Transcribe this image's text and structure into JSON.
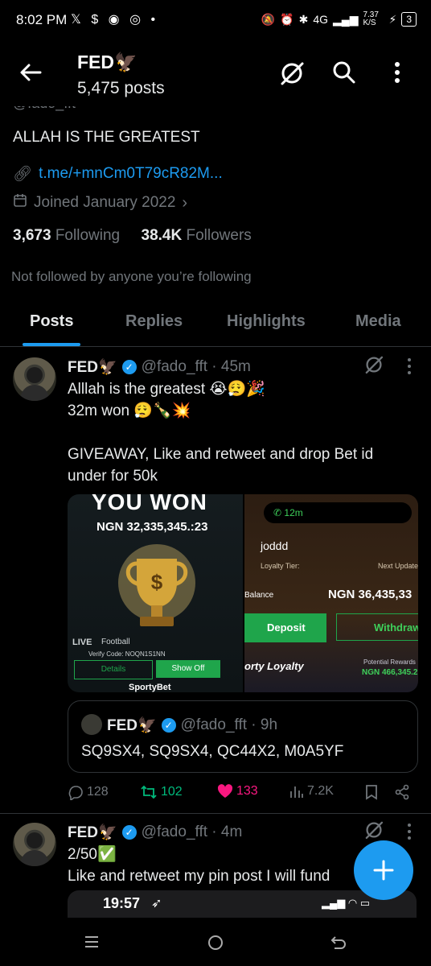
{
  "status_bar": {
    "time": "8:02 PM",
    "notif_icons": "𝕏 $ ◉ ◎ •",
    "network": "4G",
    "speed": "7.37 K/S",
    "battery": "3"
  },
  "header": {
    "title": "FED🦅",
    "posts_count": "5,475 posts"
  },
  "profile": {
    "handle_partial": "@fado_fft",
    "bio": "ALLAH IS THE GREATEST",
    "link": "t.me/+mnCm0T79cR82M...",
    "joined": "Joined January 2022",
    "following_count": "3,673",
    "following_label": "Following",
    "followers_count": "38.4K",
    "followers_label": "Followers",
    "not_followed": "Not followed by anyone you’re following"
  },
  "tabs": [
    {
      "label": "Posts",
      "active": true
    },
    {
      "label": "Replies",
      "active": false
    },
    {
      "label": "Highlights",
      "active": false
    },
    {
      "label": "Media",
      "active": false
    }
  ],
  "post1": {
    "name": "FED🦅",
    "handle_time": "@fado_fft · 45m",
    "text": "Alllah is the greatest 😭😮‍💨🎉\n32m won 😮‍💨🍾💥\n\nGIVEAWAY, Like and retweet and drop Bet id under for 50k",
    "media_left": {
      "headline": "YOU WON",
      "amount": "NGN 32,335,345.:23",
      "verify": "Verify Code: NOQN1S1NN",
      "details": "Details",
      "show_off": "Show Off",
      "brand": "SportyBet",
      "live": "LIVE",
      "football": "Football"
    },
    "media_right": {
      "call_time": "12m",
      "user": "joddd",
      "loyalty": "Loyalty Tier:",
      "next_update": "Next Update",
      "balance_label": "Balance",
      "balance": "NGN 36,435,33",
      "deposit": "Deposit",
      "withdraw": "Withdraw",
      "sporty_loyalty": "orty Loyalty",
      "potential": "Potential Rewards",
      "potential_value": "NGN 466,345.2"
    },
    "quote": {
      "name": "FED🦅",
      "handle_time": "@fado_fft · 9h",
      "text": "SQ9SX4, SQ9SX4, QC44X2, M0A5YF"
    },
    "replies": "128",
    "retweets": "102",
    "likes": "133",
    "views": "7.2K"
  },
  "post2": {
    "name": "FED🦅",
    "handle_time": "@fado_fft · 4m",
    "text": "2/50✅\nLike and retweet my pin post I will fund",
    "embed_time": "19:57"
  },
  "colors": {
    "accent": "#1d9bf0",
    "muted": "#71767b",
    "like": "#f91880",
    "retweet": "#00ba7c",
    "deposit_green": "#1fa54b"
  }
}
